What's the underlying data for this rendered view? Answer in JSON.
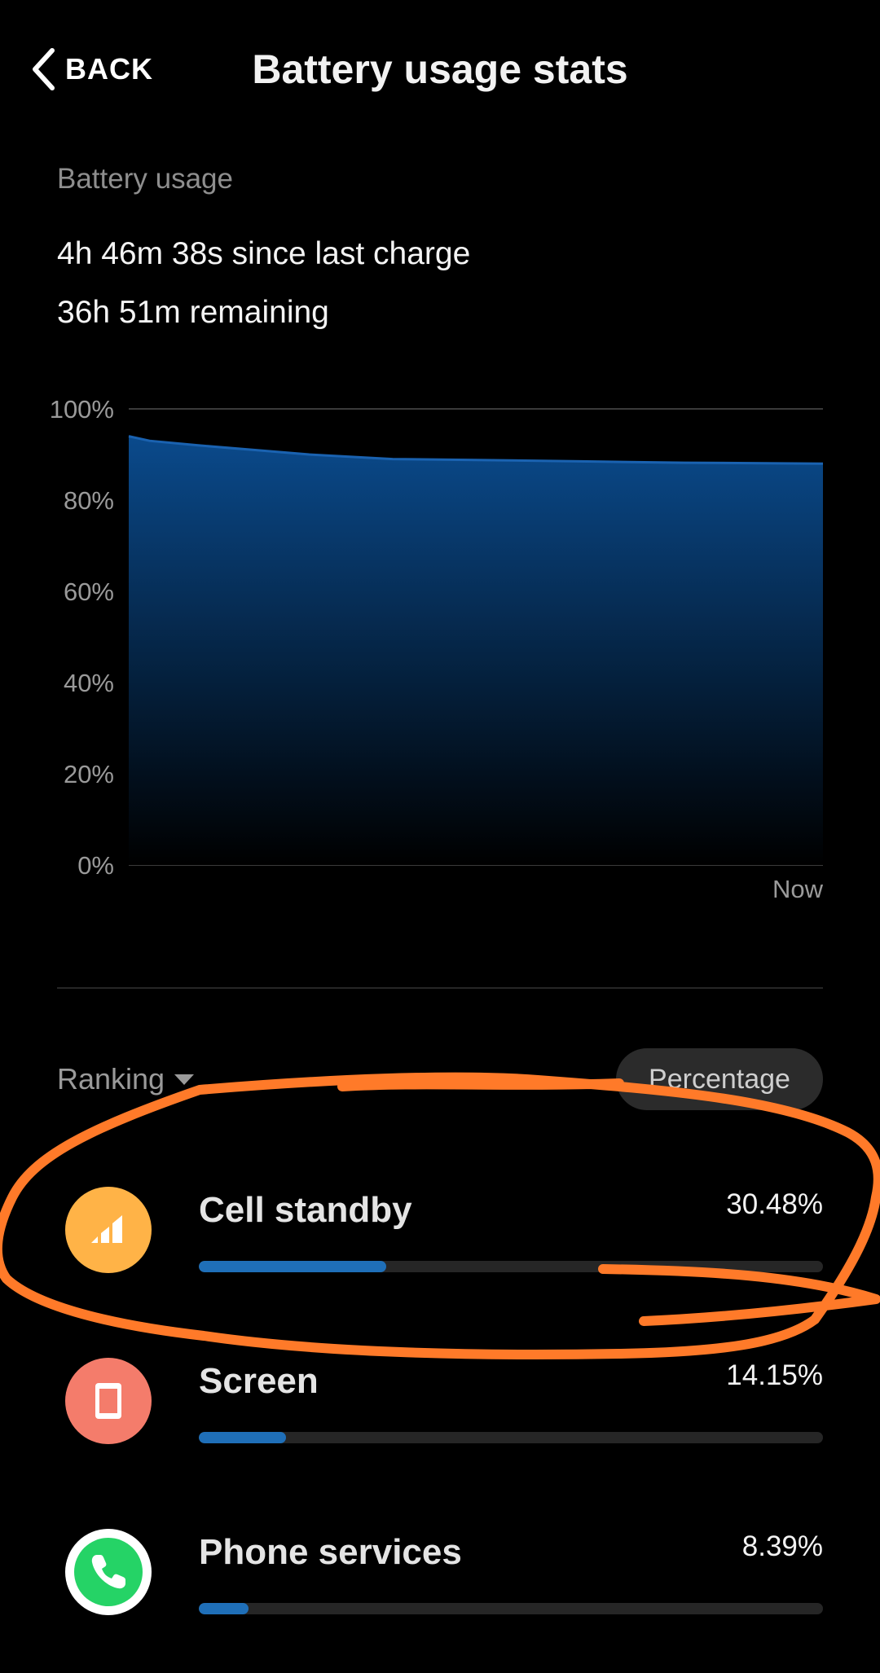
{
  "header": {
    "back_label": "BACK",
    "title": "Battery usage stats"
  },
  "summary": {
    "section_label": "Battery usage",
    "since_last_charge": "4h 46m 38s since last charge",
    "remaining": "36h 51m remaining"
  },
  "chart_data": {
    "type": "area",
    "x_end_label": "Now",
    "y_ticks": [
      "100%",
      "80%",
      "60%",
      "40%",
      "20%",
      "0%"
    ],
    "ylim": [
      0,
      100
    ],
    "grid": true,
    "series": [
      {
        "x": [
          0,
          0.03,
          0.1,
          0.18,
          0.26,
          0.38,
          0.5,
          0.65,
          0.8,
          1.0
        ],
        "values": [
          94,
          93,
          92,
          91,
          90,
          89,
          88.8,
          88.5,
          88.2,
          88
        ]
      }
    ],
    "colors": {
      "line": "#1a62b0",
      "fill_top": "#0a4a8c",
      "fill_bottom": "#000000",
      "grid": "#3a3a3a",
      "tick_label": "#9a9a9a"
    }
  },
  "controls": {
    "ranking_label": "Ranking",
    "sort_button_label": "Percentage"
  },
  "usage": [
    {
      "name": "Cell standby",
      "percent_label": "30.48%",
      "fraction": 0.3,
      "icon": "signal-bars-icon",
      "icon_color": "#ffb347"
    },
    {
      "name": "Screen",
      "percent_label": "14.15%",
      "fraction": 0.14,
      "icon": "phone-screen-icon",
      "icon_color": "#f47c6b"
    },
    {
      "name": "Phone services",
      "percent_label": "8.39%",
      "fraction": 0.08,
      "icon": "phone-handset-icon",
      "icon_color": "#25d366"
    }
  ],
  "colors": {
    "bar_fill": "#1f6fb8",
    "bar_track": "#262626",
    "annotation": "#ff7a29"
  }
}
